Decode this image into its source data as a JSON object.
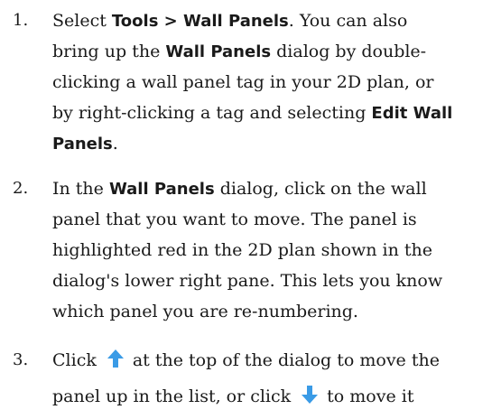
{
  "steps": [
    {
      "number": "1.",
      "lines": [
        [
          "Select ",
          "Tools > Wall Panels",
          ". You can also"
        ],
        [
          "bring up the ",
          "Wall Panels",
          " dialog by double-"
        ],
        [
          "clicking a wall panel tag in your 2D plan, or"
        ],
        [
          "by right-clicking a tag and selecting ",
          "Edit Wall"
        ],
        [
          "",
          "Panels",
          "."
        ]
      ]
    },
    {
      "number": "2.",
      "lines": [
        [
          "In the ",
          "Wall Panels",
          " dialog, click on the wall"
        ],
        [
          "panel that you want to move. The panel is"
        ],
        [
          "highlighted red in the 2D plan shown in the"
        ],
        [
          "dialog's lower right pane. This lets you know"
        ],
        [
          "which panel you are re-numbering."
        ]
      ]
    },
    {
      "number": "3.",
      "line1": [
        "Click",
        "at the top of the dialog to move the"
      ],
      "line2": [
        "panel up in the list, or click",
        "to move it"
      ],
      "icons": {
        "up": "arrow-up-icon",
        "down": "arrow-down-icon"
      },
      "colors": {
        "arrow": "#3a9be6"
      }
    }
  ]
}
